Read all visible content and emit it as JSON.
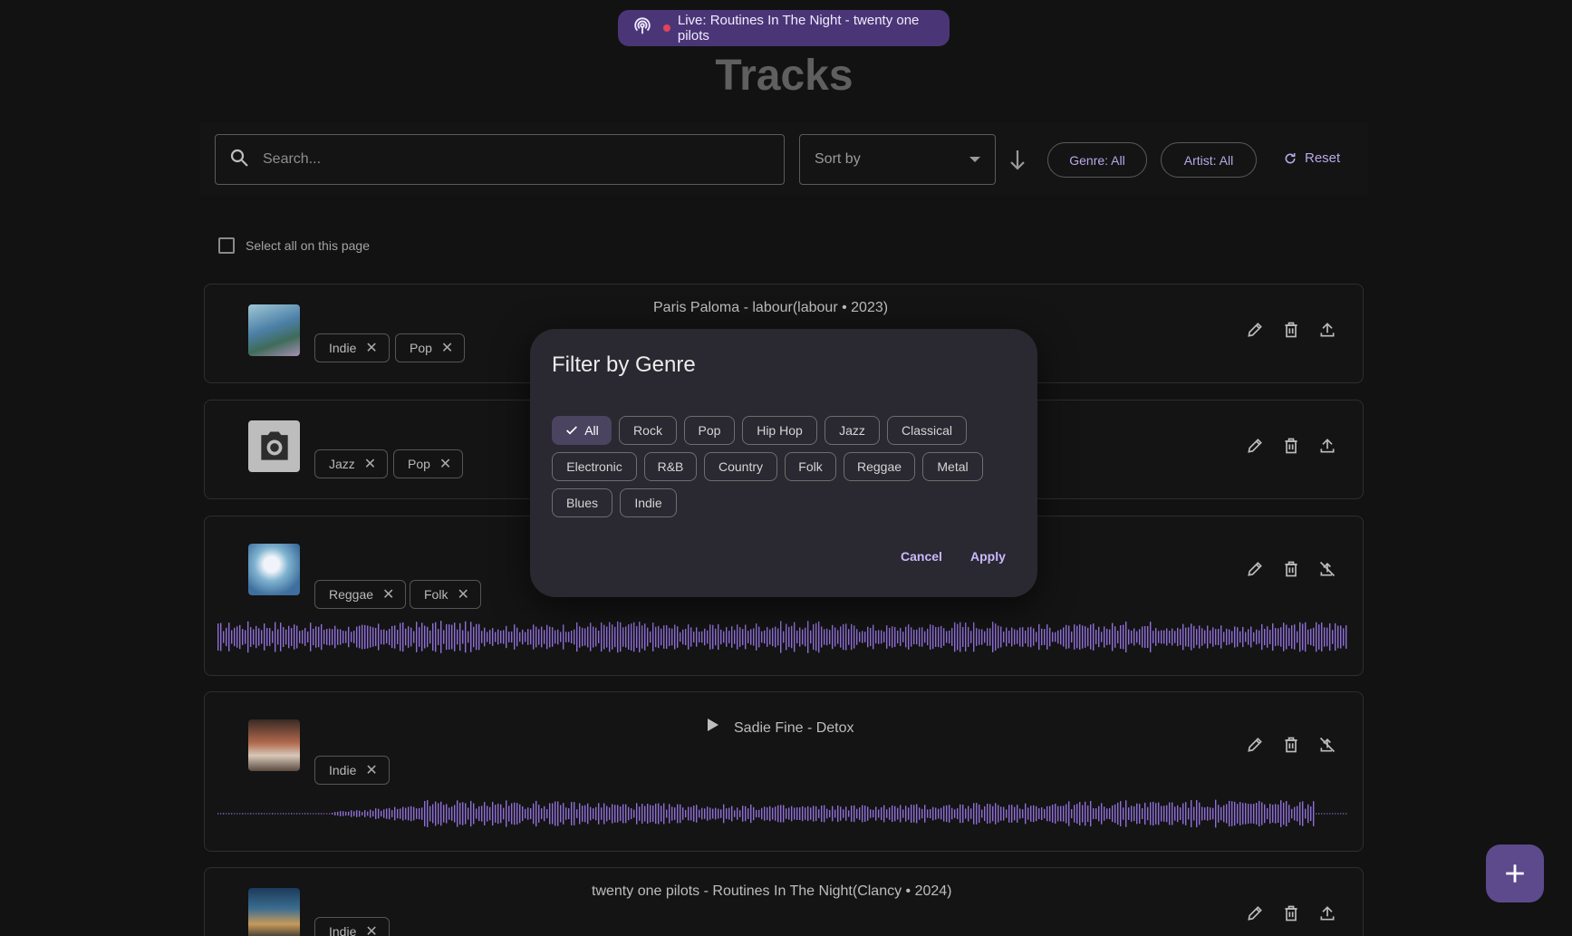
{
  "live": {
    "text": "Live: Routines In The Night - twenty one pilots"
  },
  "page": {
    "title": "Tracks"
  },
  "toolbar": {
    "search_placeholder": "Search...",
    "sort_label": "Sort by",
    "genre_filter": "Genre: All",
    "artist_filter": "Artist: All",
    "reset_label": "Reset"
  },
  "select_all": {
    "label": "Select all on this page"
  },
  "tracks": [
    {
      "title": "Paris Paloma - labour(labour • 2023)",
      "genres": [
        "Indie",
        "Pop"
      ],
      "upload": true
    },
    {
      "title": "",
      "genres": [
        "Jazz",
        "Pop"
      ],
      "upload": true
    },
    {
      "title": "",
      "genres": [
        "Reggae",
        "Folk"
      ],
      "upload": false
    },
    {
      "title": "Sadie Fine - Detox",
      "genres": [
        "Indie"
      ],
      "upload": false
    },
    {
      "title": "twenty one pilots - Routines In The Night(Clancy • 2024)",
      "genres": [
        "Indie"
      ],
      "upload": true
    }
  ],
  "dialog": {
    "title": "Filter by Genre",
    "selected": "All",
    "genres": [
      "All",
      "Rock",
      "Pop",
      "Hip Hop",
      "Jazz",
      "Classical",
      "Electronic",
      "R&B",
      "Country",
      "Folk",
      "Reggae",
      "Metal",
      "Blues",
      "Indie"
    ],
    "cancel": "Cancel",
    "apply": "Apply"
  },
  "colors": {
    "accent": "#b9a8e8",
    "waveform": "#8f6fd8",
    "live_bg": "#4a3676",
    "fab": "#5d4a8c"
  }
}
